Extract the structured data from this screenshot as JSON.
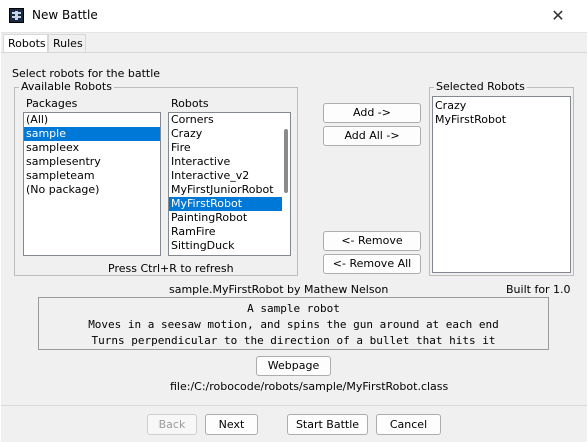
{
  "window": {
    "title": "New Battle",
    "close_glyph": "✕"
  },
  "tabs": [
    {
      "label": "Robots",
      "active": true
    },
    {
      "label": "Rules",
      "active": false
    }
  ],
  "robots_tab": {
    "instruction": "Select robots for the battle",
    "available_group": "Available Robots",
    "packages_header": "Packages",
    "robots_header": "Robots",
    "packages": [
      "(All)",
      "sample",
      "sampleex",
      "samplesentry",
      "sampleteam",
      "(No package)"
    ],
    "selected_package": "sample",
    "robots": [
      "Corners",
      "Crazy",
      "Fire",
      "Interactive",
      "Interactive_v2",
      "MyFirstJuniorRobot",
      "MyFirstRobot",
      "PaintingRobot",
      "RamFire",
      "SittingDuck"
    ],
    "selected_robot": "MyFirstRobot",
    "refresh_hint": "Press Ctrl+R to refresh",
    "buttons": {
      "add": "Add ->",
      "add_all": "Add All ->",
      "remove": "<- Remove",
      "remove_all": "<- Remove All"
    },
    "selected_group": "Selected Robots",
    "selected_robots": [
      "Crazy",
      "MyFirstRobot"
    ],
    "robot_info": {
      "name_author": "sample.MyFirstRobot by Mathew Nelson",
      "built_for": "Built for 1.0",
      "description": [
        "A sample robot",
        "Moves in a seesaw motion, and spins the gun around at each end",
        "Turns perpendicular to the direction of a bullet that hits it"
      ],
      "webpage_button": "Webpage",
      "file_path": "file:/C:/robocode/robots/sample/MyFirstRobot.class"
    }
  },
  "footer": {
    "back": "Back",
    "next": "Next",
    "start": "Start Battle",
    "cancel": "Cancel"
  },
  "colors": {
    "selection": "#0078d7",
    "background": "#f0f0f0"
  }
}
